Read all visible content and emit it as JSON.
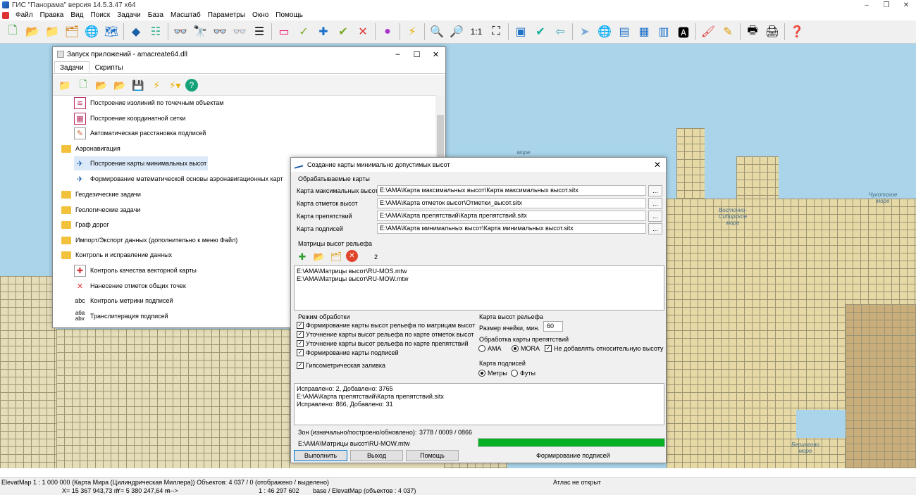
{
  "window": {
    "title": "ГИС \"Панорама\" версия 14.5.3.47 x64",
    "buttons": [
      "–",
      "❐",
      "✕"
    ]
  },
  "menu": [
    "Файл",
    "Правка",
    "Вид",
    "Поиск",
    "Задачи",
    "База",
    "Масштаб",
    "Параметры",
    "Окно",
    "Помощь"
  ],
  "toolbar": {
    "zoom_label": "1:1"
  },
  "map": {
    "labels": [
      {
        "text": "море"
      },
      {
        "text": "Чукотское\nморе"
      },
      {
        "text": "Восточно-\nСибирское\nморе"
      },
      {
        "text": "Берингово\nморе"
      }
    ]
  },
  "launcher": {
    "title": "Запуск приложений - amacreate64.dll",
    "tabs": [
      "Задачи",
      "Скрипты"
    ],
    "active_tab": 0,
    "tree": [
      {
        "label": "Построение изолиний по точечным объектам",
        "type": "task",
        "icon": "isoline-icon"
      },
      {
        "label": "Построение координатной сетки",
        "type": "task",
        "icon": "grid-icon"
      },
      {
        "label": "Автоматическая расстановка подписей",
        "type": "task",
        "icon": "labels-icon"
      },
      {
        "label": "Аэронавигация",
        "type": "folder"
      },
      {
        "label": "Построение карты минимальных высот",
        "type": "task",
        "icon": "plane-icon",
        "selected": true
      },
      {
        "label": "Формирование математической основы аэронавигационных карт",
        "type": "task",
        "icon": "chart-icon"
      },
      {
        "label": "Геодезические задачи",
        "type": "folder"
      },
      {
        "label": "Геологические задачи",
        "type": "folder"
      },
      {
        "label": "Граф дорог",
        "type": "folder"
      },
      {
        "label": "Импорт/Экспорт данных (дополнительно к меню Файл)",
        "type": "folder"
      },
      {
        "label": "Контроль и исправление данных",
        "type": "folder"
      },
      {
        "label": "Контроль качества векторной карты",
        "type": "task",
        "icon": "quality-icon"
      },
      {
        "label": "Нанесение отметок общих точек",
        "type": "task",
        "icon": "points-icon"
      },
      {
        "label": "Контроль метрики подписей",
        "type": "task",
        "icon": "abc-icon"
      },
      {
        "label": "Транслитерация подписей",
        "type": "task",
        "icon": "translit-icon"
      }
    ]
  },
  "dialog": {
    "title": "Создание карты минимально допустимых высот",
    "group_maps": "Обрабатываемые карты",
    "maps": [
      {
        "label": "Карта максимальных высот",
        "value": "E:\\AMA\\Карта максимальных высот\\Карта максимальных высот.sitx"
      },
      {
        "label": "Карта отметок высот",
        "value": "E:\\AMA\\Карта отметок высот\\Отметки_высот.sitx"
      },
      {
        "label": "Карта препятствий",
        "value": "E:\\AMA\\Карта препятствий\\Карта препятствий.sitx"
      },
      {
        "label": "Карта подписей",
        "value": "E:\\AMA\\Карта минимальных высот\\Карта минимальных высот.sitx"
      }
    ],
    "browse_label": "...",
    "group_matrices": "Матрицы высот рельефа",
    "matrix_count": "2",
    "matrices": [
      "E:\\AMA\\Матрицы высот\\RU-MOS.mtw",
      "E:\\AMA\\Матрицы высот\\RU-MOW.mtw"
    ],
    "group_mode": "Режим обработки",
    "mode_options": [
      {
        "label": "Формирование карты высот рельефа по матрицам высот",
        "checked": true
      },
      {
        "label": "Уточнение карты высот рельефа по карте отметок высот",
        "checked": true
      },
      {
        "label": "Уточнение карты высот рельефа по карте препятствий",
        "checked": true
      },
      {
        "label": "Формирование карты подписей",
        "checked": true
      },
      {
        "label": "Гипсометрическая заливка",
        "checked": true
      }
    ],
    "group_relief": "Карта высот рельефа",
    "cell_size_label": "Размер ячейки, мин.",
    "cell_size": "60",
    "group_obstacles": "Обработка карты препятствий",
    "obstacle_options": [
      {
        "label": "AMA",
        "selected": false
      },
      {
        "label": "MORA",
        "selected": true
      }
    ],
    "no_relative_label": "Не добавлять относительную высоту",
    "no_relative_checked": true,
    "group_labels": "Карта подписей",
    "unit_options": [
      {
        "label": "Метры",
        "selected": true
      },
      {
        "label": "Футы",
        "selected": false
      }
    ],
    "log": [
      "Исправлено: 2, Добавлено: 3765",
      "E:\\AMA\\Карта препятствий\\Карта препятствий.sitx",
      "Исправлено: 866, Добавлено: 31"
    ],
    "zones_label": "Зон (изначально/построено/обновлено):",
    "zones_value": "3778 / 0009 / 0866",
    "current_file": "E:\\AMA\\Матрицы высот\\RU-MOW.mtw",
    "progress": 1.0,
    "btn_run": "Выполнить",
    "btn_exit": "Выход",
    "btn_help": "Помощь",
    "stage": "Формирование подписей"
  },
  "status": {
    "map_info": "ElevatMap  1 : 1 000 000 (Карта Мира (Цилиндрическая Миллера))  Объектов: 4 037 / 0 (отображено / выделено)",
    "atlas": "Атлас не открыт",
    "x": "X= 15 367 943,73 m",
    "y": "Y= 5 380 247,64 m",
    "arrows": "<-->",
    "scale": "1 : 46 297 602",
    "layer": "base / ElevatMap  (объектов : 4 037)"
  }
}
